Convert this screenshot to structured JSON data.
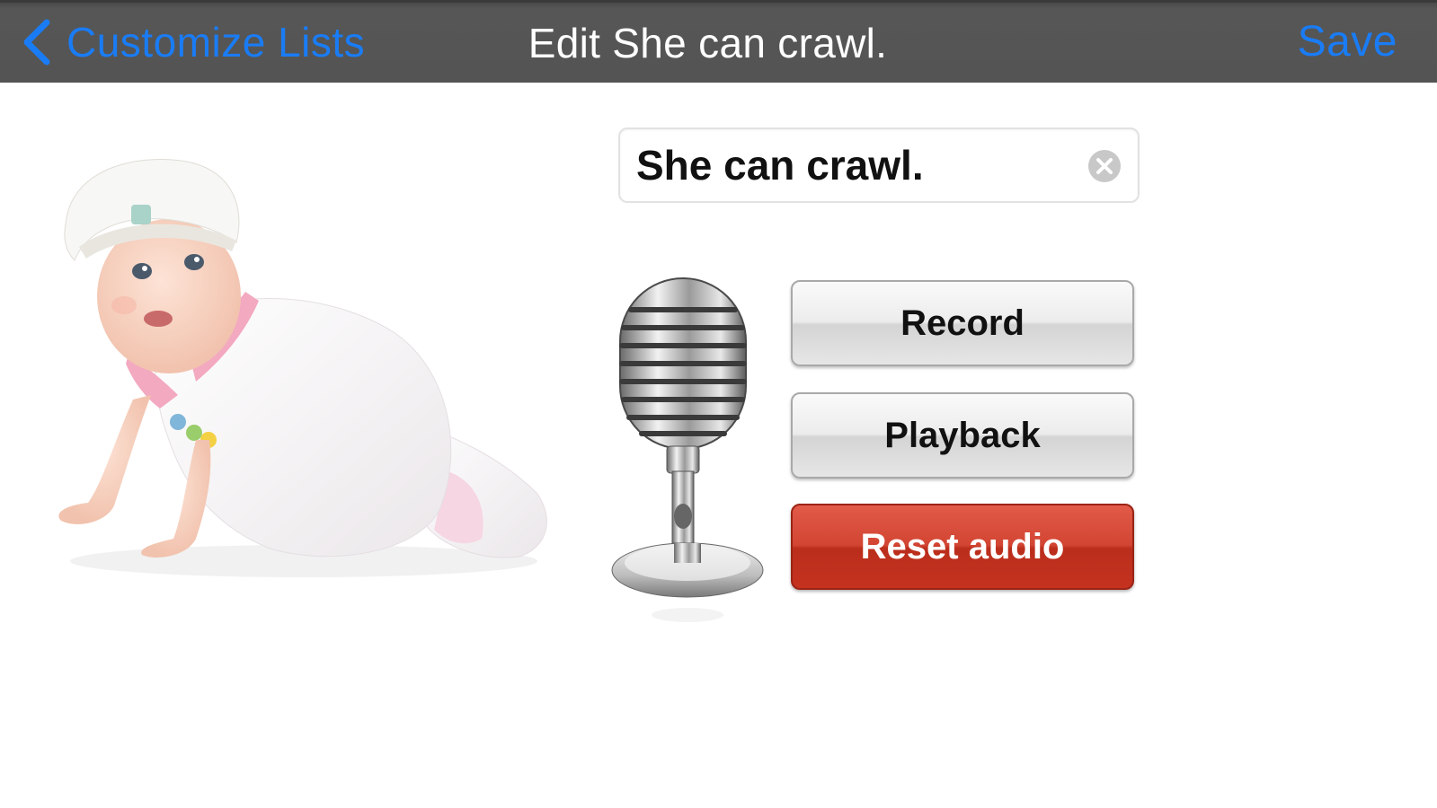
{
  "navbar": {
    "back_label": "Customize Lists",
    "title": "Edit She can crawl.",
    "save_label": "Save"
  },
  "phrase_field": {
    "value": "She can crawl."
  },
  "audio": {
    "record_label": "Record",
    "playback_label": "Playback",
    "reset_label": "Reset audio"
  },
  "colors": {
    "accent": "#1a7cf5",
    "navbar_bg": "#545454",
    "reset_button": "#c5321f"
  },
  "icons": [
    "chevron-left-icon",
    "clear-icon",
    "microphone-icon"
  ]
}
